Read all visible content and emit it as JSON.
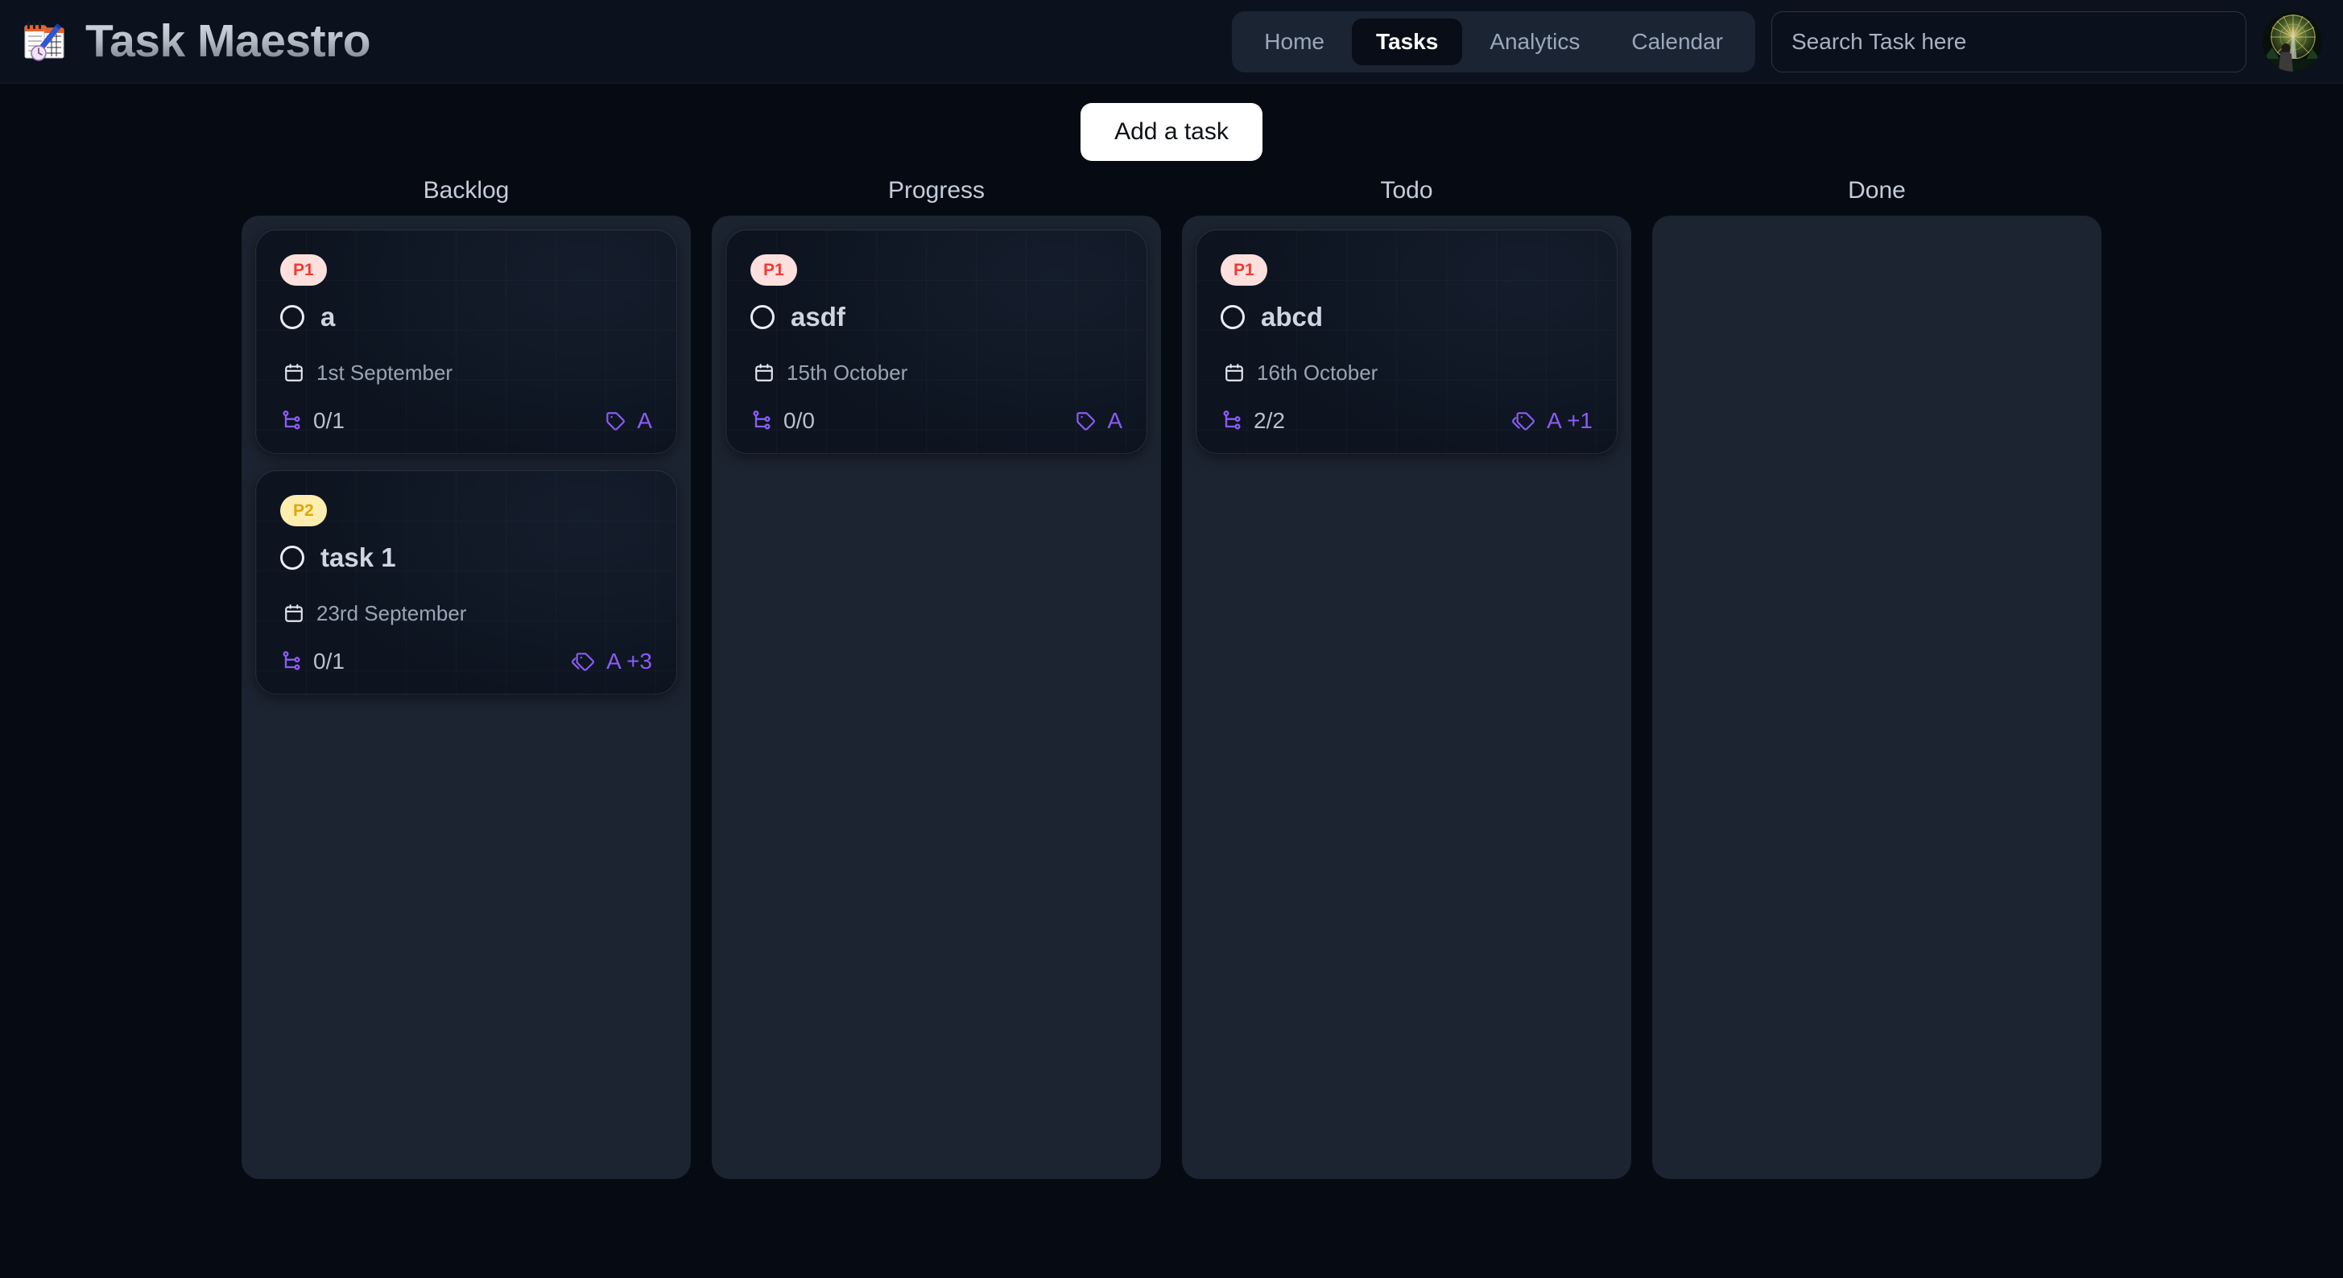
{
  "app": {
    "title": "Task Maestro",
    "logo_icon": "spiral-notepad-calendar-icon"
  },
  "header": {
    "nav": [
      {
        "label": "Home",
        "active": false
      },
      {
        "label": "Tasks",
        "active": true
      },
      {
        "label": "Analytics",
        "active": false
      },
      {
        "label": "Calendar",
        "active": false
      }
    ],
    "search": {
      "value": "",
      "placeholder": "Search Task here"
    },
    "avatar_icon": "user-avatar-photo"
  },
  "toolbar": {
    "add_task_label": "Add a task"
  },
  "colors": {
    "page_bg": "#060a12",
    "topbar_bg": "#0b111d",
    "column_bg": "#1c2431",
    "card_bg": "#0d1420",
    "accent_purple": "#8b5cf6",
    "p1_bg": "#fde0dd",
    "p1_text": "#ef3b32",
    "p2_bg": "#fdeeb0",
    "p2_text": "#e3a40a",
    "nav_active_bg": "#080d17",
    "add_button_bg": "#ffffff"
  },
  "board": {
    "columns": [
      {
        "title": "Backlog",
        "cards": [
          {
            "priority": "P1",
            "priority_class": "p1",
            "title": "a",
            "date": "1st September",
            "date_icon": "calendar-icon",
            "subtasks": "0/1",
            "subtask_icon": "git-fork-icon",
            "tags": "A",
            "tag_icon": "tag-icon",
            "raised": true
          },
          {
            "priority": "P2",
            "priority_class": "p2",
            "title": "task 1",
            "date": "23rd September",
            "date_icon": "calendar-icon",
            "subtasks": "0/1",
            "subtask_icon": "git-fork-icon",
            "tags": "A +3",
            "tag_icon": "tags-icon",
            "raised": true
          }
        ]
      },
      {
        "title": "Progress",
        "cards": [
          {
            "priority": "P1",
            "priority_class": "p1",
            "title": "asdf",
            "date": "15th October",
            "date_icon": "calendar-icon",
            "subtasks": "0/0",
            "subtask_icon": "git-fork-icon",
            "tags": "A",
            "tag_icon": "tag-icon",
            "raised": true
          }
        ]
      },
      {
        "title": "Todo",
        "cards": [
          {
            "priority": "P1",
            "priority_class": "p1",
            "title": "abcd",
            "date": "16th October",
            "date_icon": "calendar-icon",
            "subtasks": "2/2",
            "subtask_icon": "git-fork-icon",
            "tags": "A +1",
            "tag_icon": "tags-icon",
            "raised": true
          }
        ]
      },
      {
        "title": "Done",
        "cards": []
      }
    ]
  }
}
